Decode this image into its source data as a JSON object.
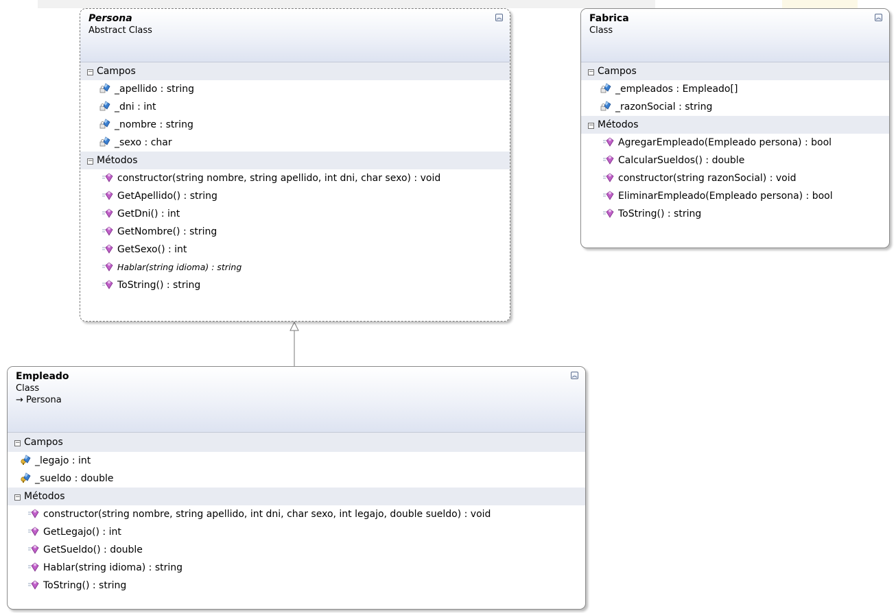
{
  "classes": {
    "persona": {
      "name": "Persona",
      "kind": "Abstract Class",
      "campos_label": "Campos",
      "metodos_label": "Métodos",
      "fields": [
        "_apellido : string",
        "_dni : int",
        "_nombre : string",
        "_sexo : char"
      ],
      "methods": [
        "constructor(string nombre, string apellido, int dni, char sexo) : void",
        "GetApellido() : string",
        "GetDni() : int",
        "GetNombre() : string",
        "GetSexo() : int",
        "Hablar(string idioma) : string",
        "ToString() : string"
      ]
    },
    "fabrica": {
      "name": "Fabrica",
      "kind": "Class",
      "campos_label": "Campos",
      "metodos_label": "Métodos",
      "fields": [
        "_empleados : Empleado[]",
        "_razonSocial : string"
      ],
      "methods": [
        "AgregarEmpleado(Empleado persona) : bool",
        "CalcularSueldos() : double",
        "constructor(string razonSocial) : void",
        "EliminarEmpleado(Empleado persona) : bool",
        "ToString() : string"
      ]
    },
    "empleado": {
      "name": "Empleado",
      "kind": "Class",
      "base": "→ Persona",
      "campos_label": "Campos",
      "metodos_label": "Métodos",
      "fields": [
        "_legajo : int",
        "_sueldo : double"
      ],
      "methods": [
        "constructor(string nombre, string apellido, int dni, char sexo, int legajo, double sueldo) : void",
        "GetLegajo() : int",
        "GetSueldo() : double",
        "Hablar(string idioma) : string",
        "ToString() : string"
      ]
    }
  },
  "icons": {
    "field": "field-icon",
    "method": "method-icon",
    "collapse": "collapse-icon"
  },
  "colors": {
    "header_gradient_end": "#dde3f1",
    "section_bg": "#e8ebf2",
    "border": "#8a8a8a",
    "method_icon": "#c060c8",
    "field_icon": "#3a7fd0"
  }
}
